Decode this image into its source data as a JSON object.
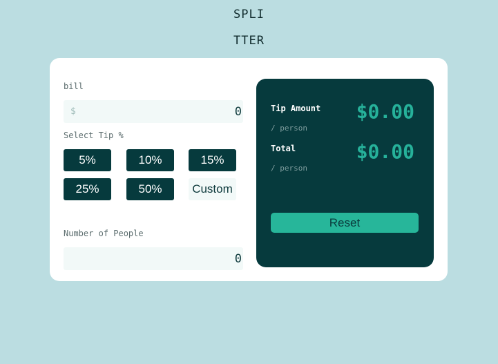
{
  "header": {
    "logo_line1": "SPLI",
    "logo_line2": "TTER"
  },
  "bill": {
    "label": "bill",
    "prefix": "$",
    "value": "0"
  },
  "tip": {
    "label": "Select Tip %",
    "options": [
      "5%",
      "10%",
      "15%",
      "25%",
      "50%"
    ],
    "custom_label": "Custom"
  },
  "people": {
    "label": "Number of People",
    "value": "0"
  },
  "results": {
    "tip_amount_title": "Tip Amount",
    "tip_amount_sub": "/ person",
    "tip_amount_value": "$0.00",
    "total_title": "Total",
    "total_sub": "/ person",
    "total_value": "$0.00",
    "reset_label": "Reset"
  },
  "colors": {
    "background": "#bbdde1",
    "card": "#ffffff",
    "dark_teal": "#063a3d",
    "accent": "#26b19a",
    "input_bg": "#f2f9f8"
  }
}
